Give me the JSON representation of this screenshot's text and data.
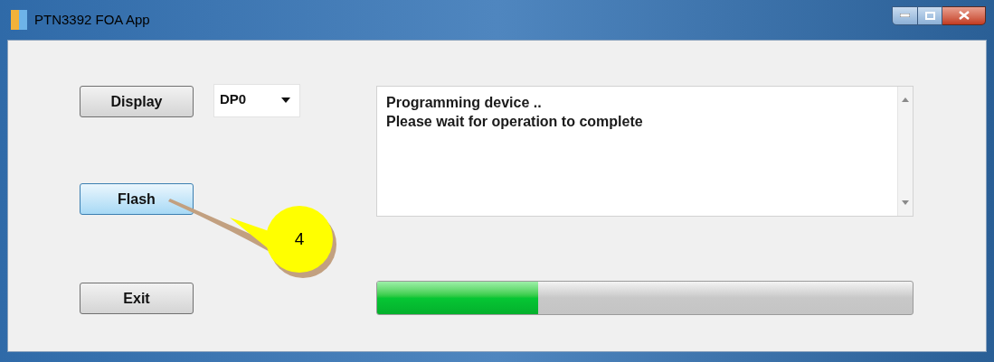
{
  "window": {
    "title": "PTN3392 FOA App"
  },
  "buttons": [
    {
      "label": "Display",
      "focused": false
    },
    {
      "label": "Flash",
      "focused": true
    },
    {
      "label": "Exit",
      "focused": false
    }
  ],
  "port_dropdown": {
    "value": "DP0"
  },
  "log": {
    "lines": [
      "Programming device ..",
      "Please wait for operation to complete"
    ]
  },
  "progress": {
    "level": 0.3
  },
  "callout": {
    "text": "4"
  }
}
